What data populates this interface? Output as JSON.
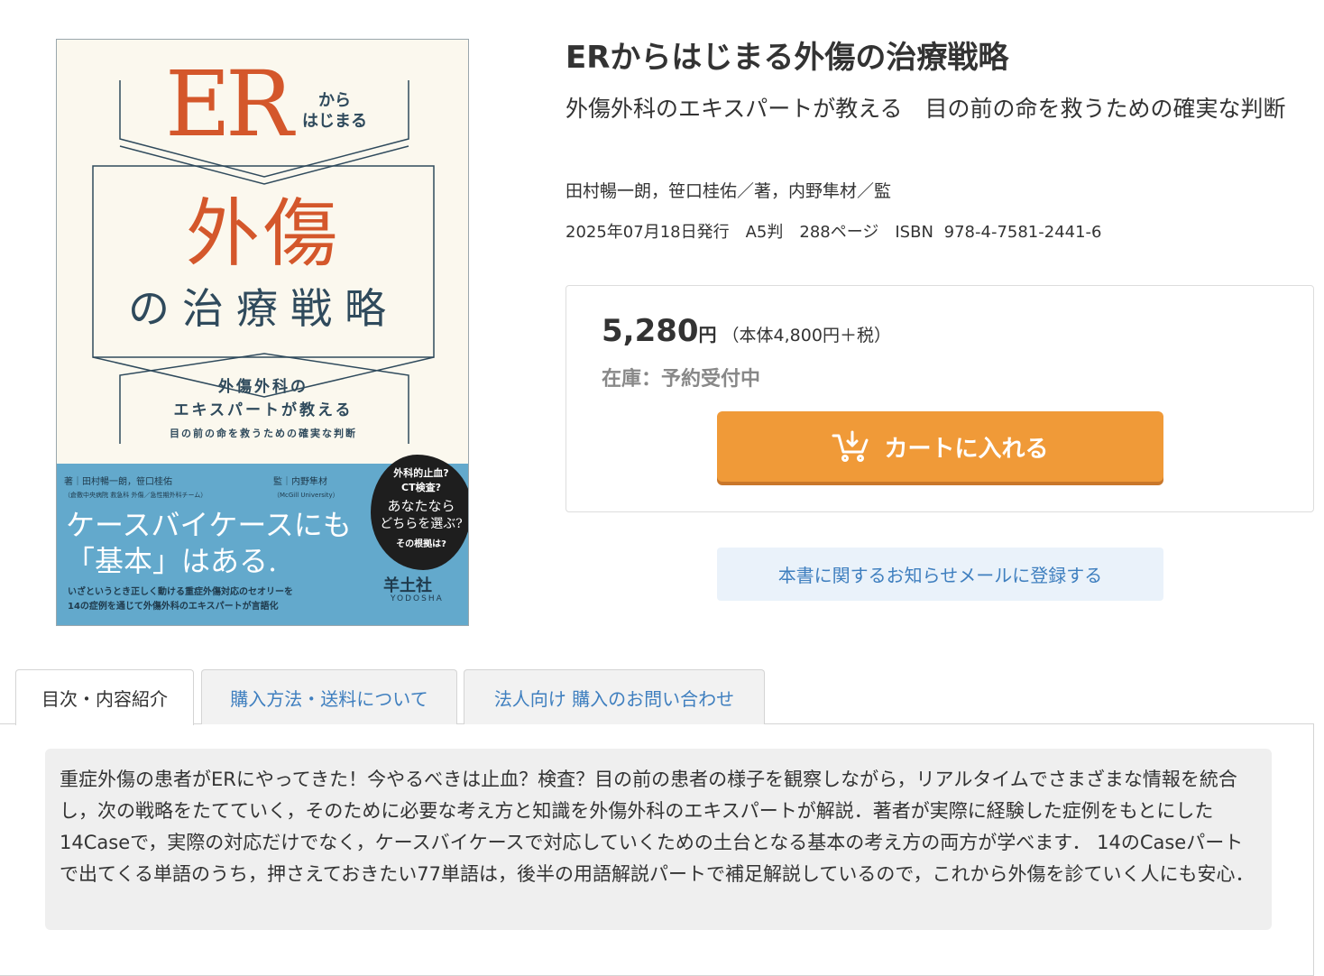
{
  "cover": {
    "er": "ER",
    "kara": "から",
    "hajimaru": "はじまる",
    "big": "外傷",
    "big2": "の治療戦略",
    "sub1": "外傷外科の",
    "sub2": "エキスパートが教える",
    "sub3": "目の前の命を救うための確実な判断",
    "author_label": "著",
    "author_names": "田村暢一朗，笹口桂佑",
    "author_affil": "（倉敷中央病院 救急科 外傷／急性期外科チーム）",
    "sup_label": "監",
    "sup_name": "内野隼材",
    "sup_affil": "（McGill University）",
    "case_line1": "ケースバイケースにも",
    "case_line2": "「基本」はある.",
    "desc1": "いざというとき正しく動ける重症外傷対応のセオリーを",
    "desc2": "14の症例を通じて外傷外科のエキスパートが言語化",
    "blob1": "外科的止血?",
    "blob2": "CT検査?",
    "blob3": "あなたなら",
    "blob4": "どちらを選ぶ?",
    "blob5": "その根拠は?",
    "publisher": "羊土社",
    "publisher_en": "YODOSHA"
  },
  "book": {
    "title": "ERからはじまる外傷の治療戦略",
    "subtitle": "外傷外科のエキスパートが教える　目の前の命を救うための確実な判断",
    "authors": "田村暢一朗，笹口桂佑／著，内野隼材／監",
    "meta": "2025年07月18日発行　A5判　288ページ　ISBN 978-4-7581-2441-6"
  },
  "purchase": {
    "price": "5,280",
    "yen": "円",
    "tax_note": "（本体4,800円＋税）",
    "stock": "在庫：予約受付中",
    "cart_label": "カートに入れる",
    "mail_label": "本書に関するお知らせメールに登録する"
  },
  "tabs": [
    {
      "label": "目次・内容紹介"
    },
    {
      "label": "購入方法・送料について"
    },
    {
      "label": "法人向け 購入のお問い合わせ"
    }
  ],
  "intro": "重症外傷の患者がERにやってきた！今やるべきは止血？検査？目の前の患者の様子を観察しながら，リアルタイムでさまざまな情報を統合し，次の戦略をたてていく，そのために必要な考え方と知識を外傷外科のエキスパートが解説．著者が実際に経験した症例をもとにした14Caseで，実際の対応だけでなく，ケースバイケースで対応していくための土台となる基本の考え方の両方が学べます． 14のCaseパートで出てくる単語のうち，押さえておきたい77単語は，後半の用語解説パートで補足解説しているので，これから外傷を診ていく人にも安心．",
  "colors": {
    "accent_orange": "#f09a38",
    "link_blue": "#3f7fbf",
    "cover_orange": "#d4572b",
    "cover_blue": "#63a9cc"
  }
}
